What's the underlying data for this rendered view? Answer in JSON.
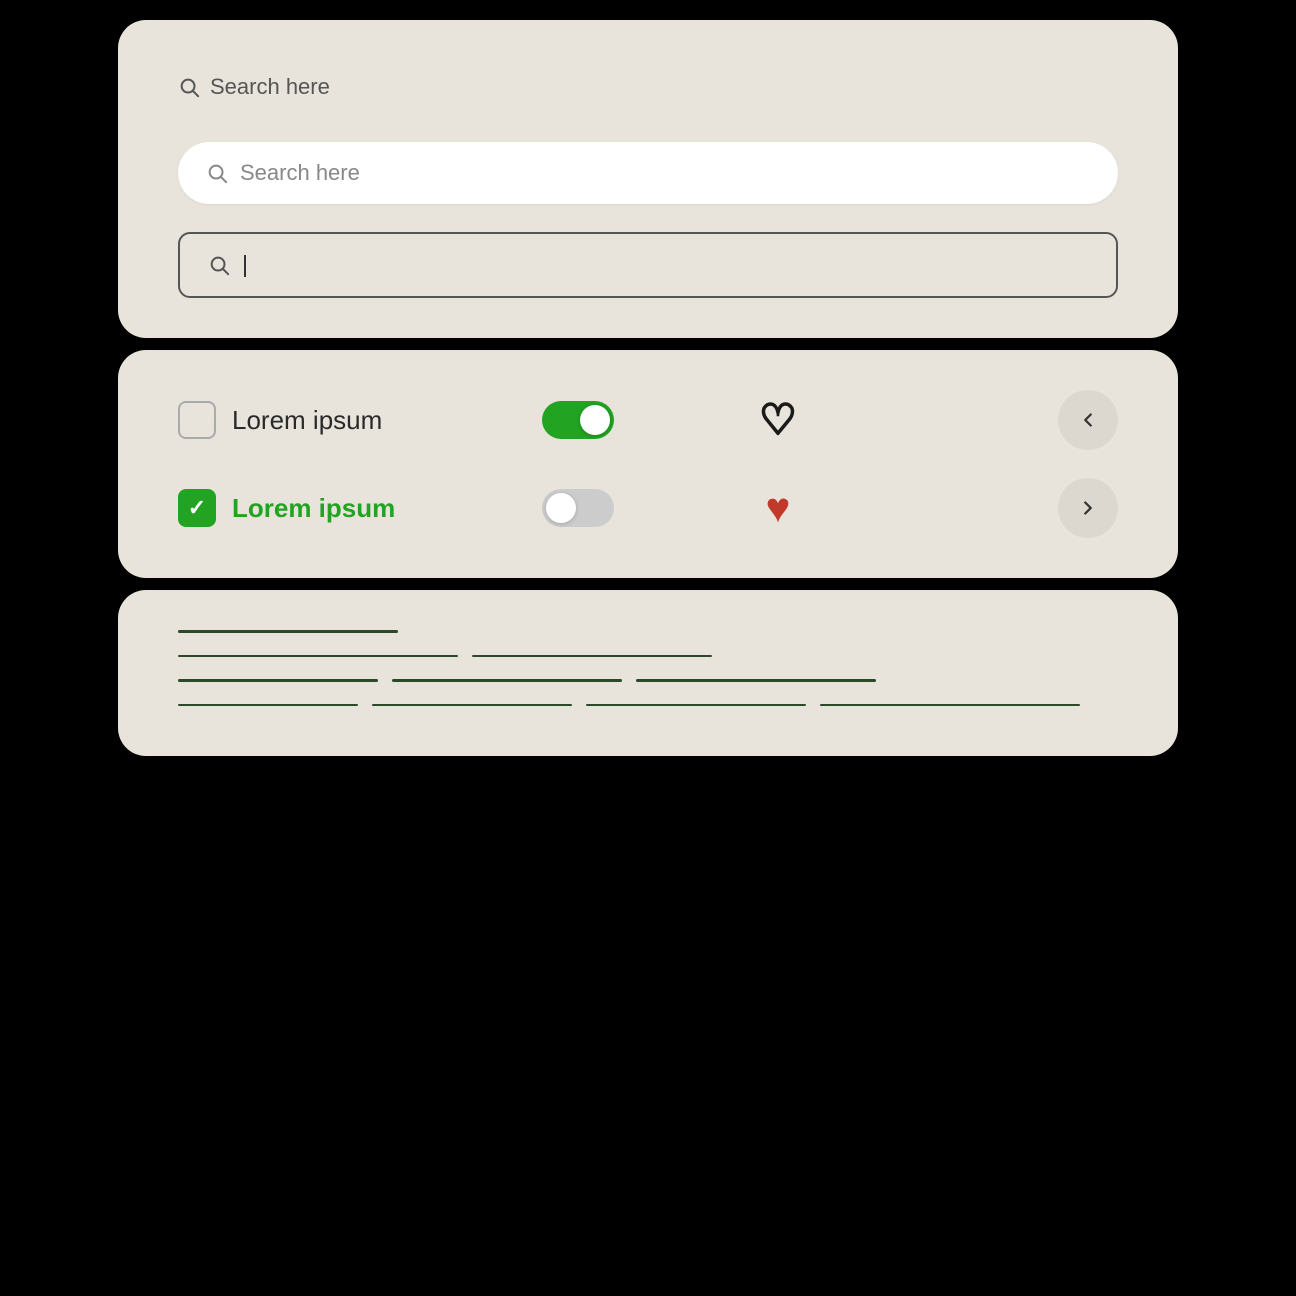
{
  "search": {
    "placeholder": "Search here",
    "plain_label": "Search here",
    "white_label": "Search here"
  },
  "controls": {
    "row1": {
      "checkbox_label": "Lorem ipsum",
      "toggle_state": "on",
      "heart_state": "outline",
      "chevron_direction": "left"
    },
    "row2": {
      "checkbox_label": "Lorem ipsum",
      "toggle_state": "off",
      "heart_state": "filled",
      "chevron_direction": "right"
    }
  },
  "icons": {
    "search": "search-icon",
    "check": "✓",
    "heart_outline": "♡",
    "heart_filled": "♥",
    "chevron_left": "<",
    "chevron_right": ">"
  },
  "colors": {
    "background": "#000000",
    "card_bg": "#e8e4dc",
    "green": "#22a322",
    "line_color": "#2a4a2a",
    "text_dark": "#2a2a2a",
    "text_muted": "#888888"
  }
}
